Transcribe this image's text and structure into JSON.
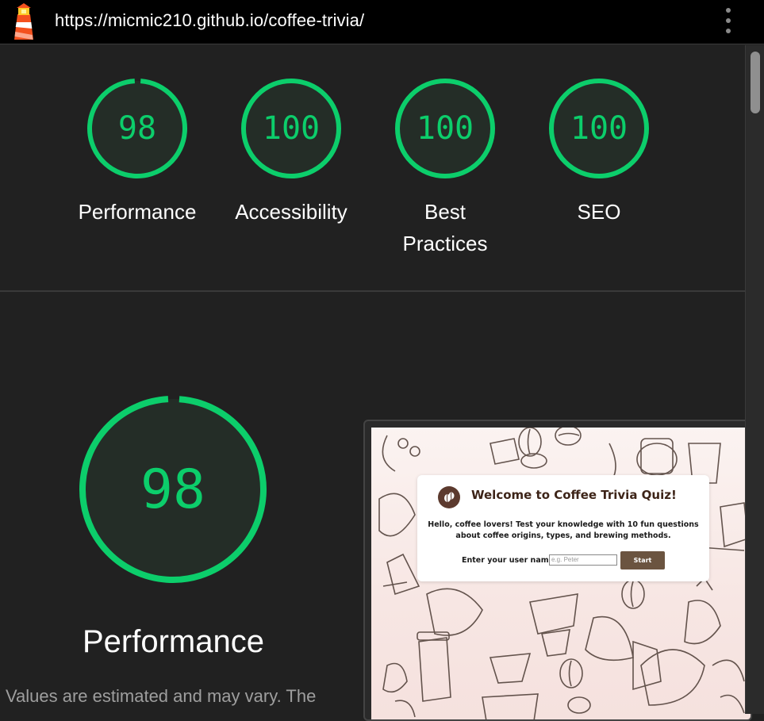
{
  "topbar": {
    "url": "https://micmic210.github.io/coffee-trivia/",
    "logo_icon": "lighthouse-icon",
    "menu_icon": "more-vertical-icon"
  },
  "colors": {
    "pass": "#0cce6b",
    "background": "#212121"
  },
  "summary_scores": [
    {
      "score": "98",
      "value": 0.98,
      "label": "Performance"
    },
    {
      "score": "100",
      "value": 1.0,
      "label": "Accessibility"
    },
    {
      "score": "100",
      "value": 1.0,
      "label": "Best Practices"
    },
    {
      "score": "100",
      "value": 1.0,
      "label": "SEO"
    }
  ],
  "performance": {
    "score": "98",
    "value": 0.98,
    "title": "Performance",
    "description": "Values are estimated and may vary. The"
  },
  "screenshot": {
    "title": "Welcome to Coffee Trivia Quiz!",
    "body": "Hello, coffee lovers! Test your knowledge with 10 fun questions about coffee origins, types, and brewing methods.",
    "username_label": "Enter your user name",
    "username_placeholder": "e.g. Peter",
    "start_label": "Start"
  }
}
